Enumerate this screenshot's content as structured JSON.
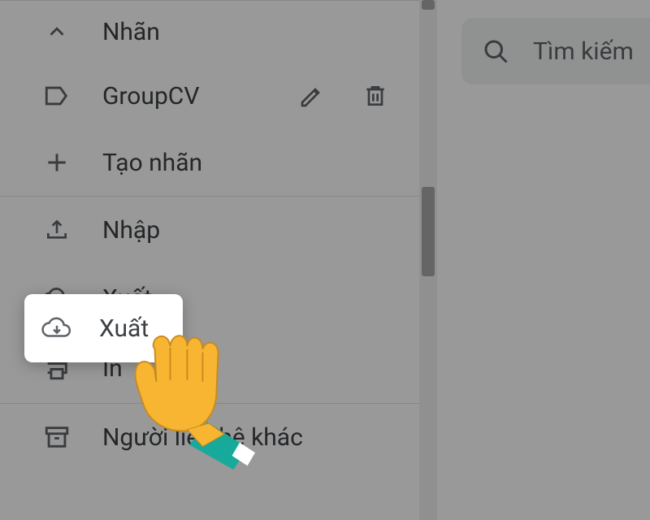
{
  "search": {
    "placeholder": "Tìm kiếm"
  },
  "labels": {
    "section_title": "Nhãn",
    "items": [
      {
        "name": "GroupCV"
      }
    ],
    "create": "Tạo nhãn"
  },
  "actions": {
    "import": "Nhập",
    "export": "Xuất",
    "print": "In"
  },
  "other_contacts": "Người liên hệ khác"
}
